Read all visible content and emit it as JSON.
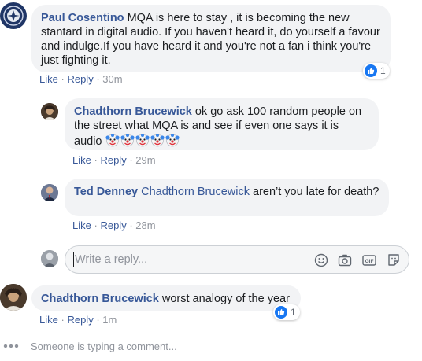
{
  "comments": [
    {
      "author": "Paul Cosentino",
      "text": "MQA is here to stay , it is becoming the new stantard in digital audio. If you haven't heard it, do yourself a favour and indulge.If you have heard it and you're not a fan i think you're just fighting it.",
      "like_label": "Like",
      "reply_label": "Reply",
      "time": "30m",
      "reaction_count": "1"
    },
    {
      "author": "Chadthorn Brucewick",
      "text": "ok go ask 100 random people on the street what MQA is and see if even one says it is audio",
      "emoji_count": 5,
      "like_label": "Like",
      "reply_label": "Reply",
      "time": "29m"
    },
    {
      "author": "Ted Denney",
      "tagged_user": "Chadthorn Brucewick",
      "text": "aren’t you late for death?",
      "like_label": "Like",
      "reply_label": "Reply",
      "time": "28m"
    },
    {
      "author": "Chadthorn Brucewick",
      "text": "worst analogy of the year",
      "like_label": "Like",
      "reply_label": "Reply",
      "time": "1m",
      "reaction_count": "1"
    }
  ],
  "reply_composer": {
    "placeholder": "Write a reply...",
    "tools": [
      "emoji-icon",
      "camera-icon",
      "gif-icon",
      "sticker-icon"
    ]
  },
  "typing_indicator": "Someone is typing a comment...",
  "colors": {
    "link": "#385898",
    "bubble": "#f2f3f5",
    "like_blue": "#1877f2",
    "muted": "#90949c"
  }
}
